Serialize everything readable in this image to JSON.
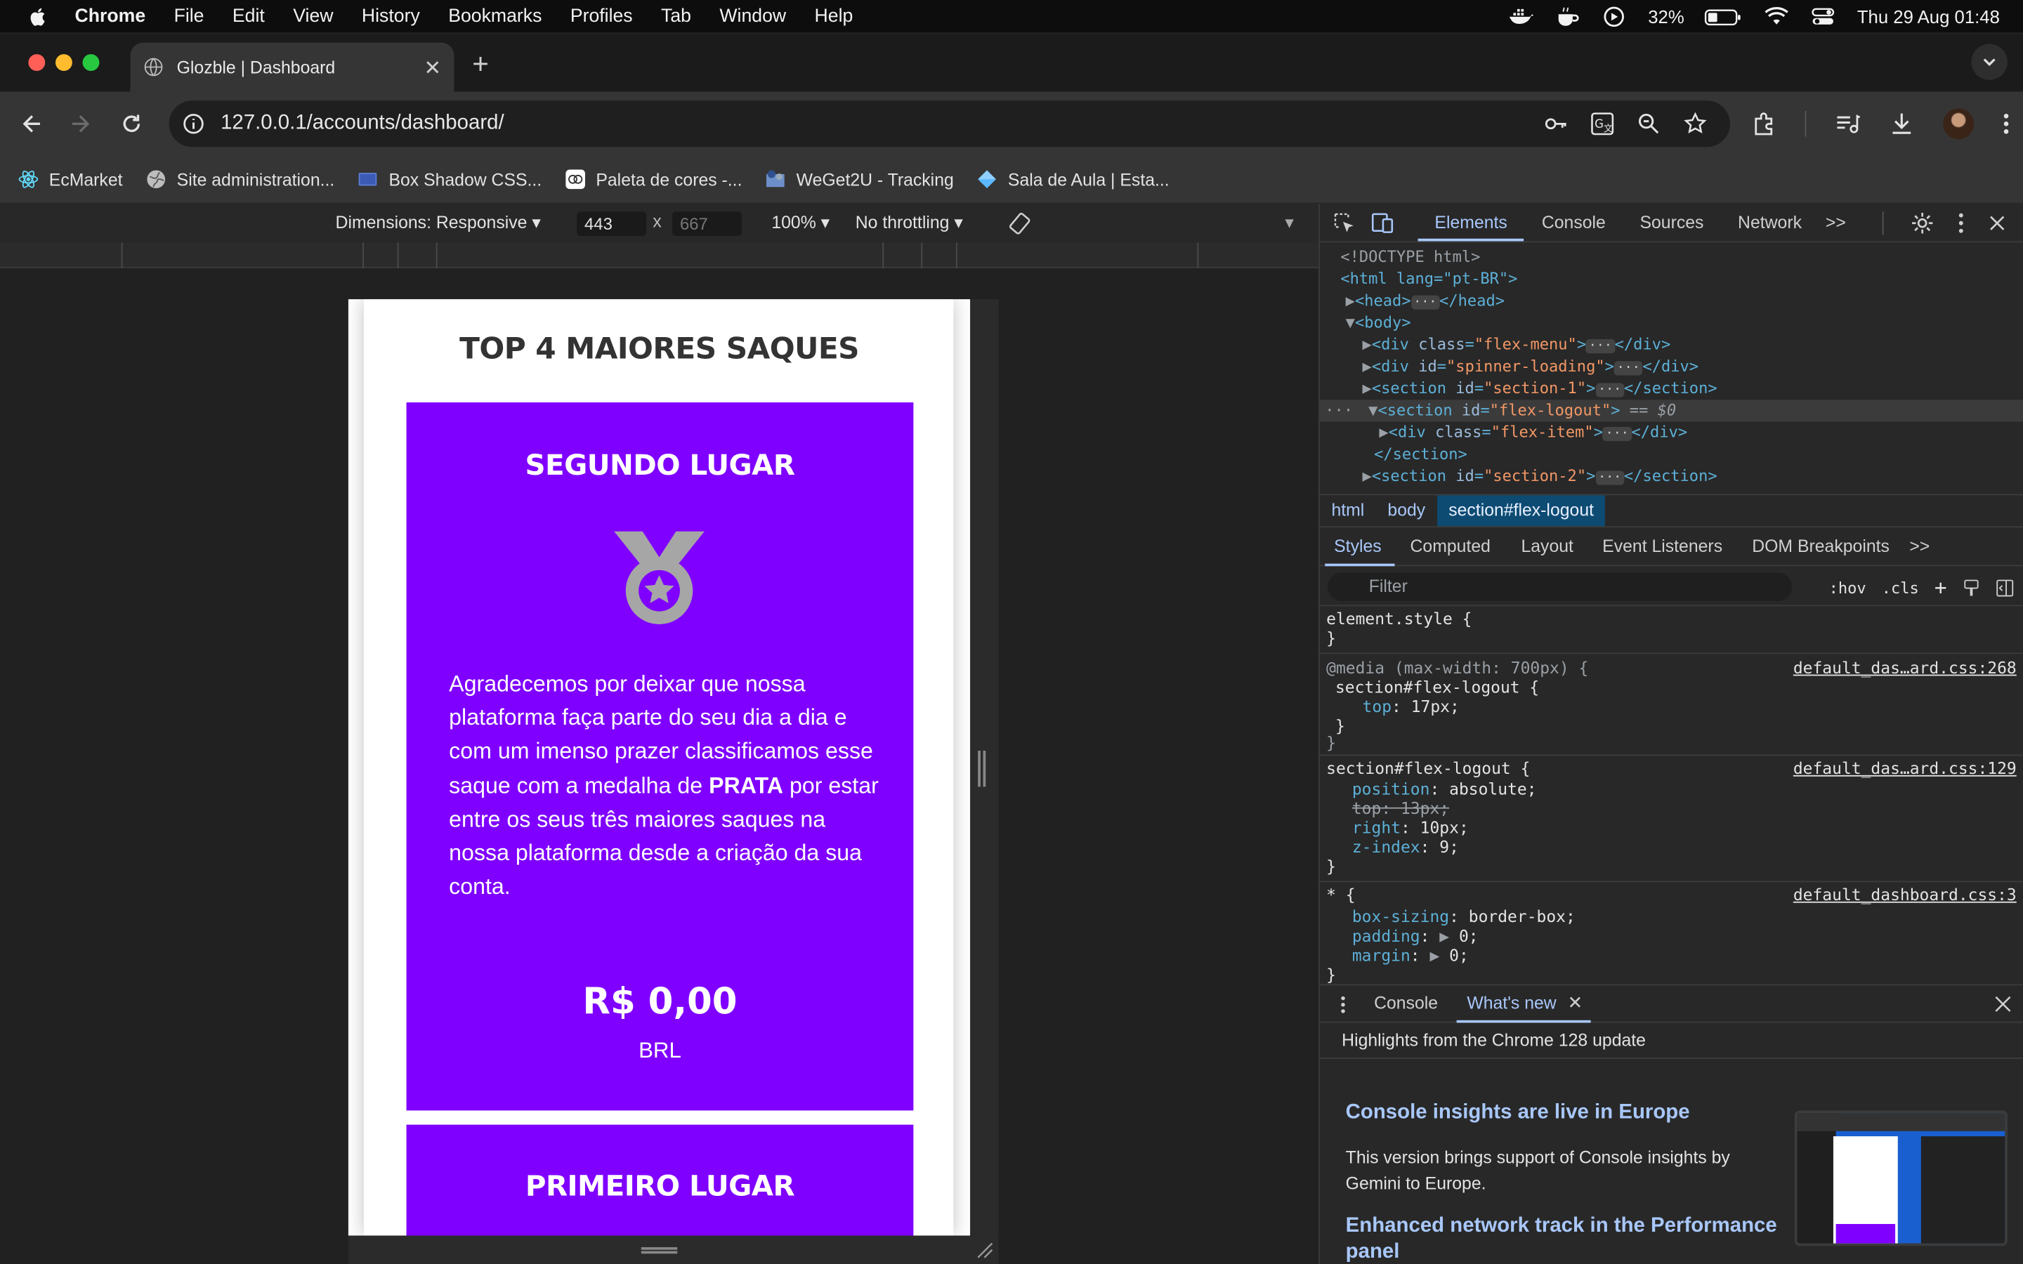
{
  "menubar": {
    "app": "Chrome",
    "items": [
      "File",
      "Edit",
      "View",
      "History",
      "Bookmarks",
      "Profiles",
      "Tab",
      "Window",
      "Help"
    ],
    "battery": "32%",
    "datetime": "Thu 29 Aug  01:48"
  },
  "tab": {
    "title": "Glozble | Dashboard"
  },
  "address": {
    "url": "127.0.0.1/accounts/dashboard/"
  },
  "bookmarks": [
    "EcMarket",
    "Site administration...",
    "Box Shadow CSS...",
    "Paleta de cores -...",
    "WeGet2U - Tracking",
    "Sala de Aula | Esta..."
  ],
  "device_toolbar": {
    "dimensions": "Dimensions: Responsive",
    "width": "443",
    "height": "667",
    "zoom": "100%",
    "throttling": "No throttling",
    "times": "x"
  },
  "page": {
    "title": "TOP 4 MAIORES SAQUES",
    "card1": {
      "title": "SEGUNDO LUGAR",
      "desc_before": "Agradecemos por deixar que nossa plataforma faça parte do seu dia a dia e com um imenso prazer classificamos esse saque com a medalha de ",
      "desc_bold": "PRATA",
      "desc_after": " por estar entre os seus três maiores saques na nossa plataforma desde a criação da sua conta.",
      "amount": "R$ 0,00",
      "currency": "BRL",
      "medal_color": "#a6a6a6"
    },
    "card2": {
      "title": "PRIMEIRO LUGAR"
    },
    "accent": "#7f00ff"
  },
  "devtools": {
    "tabs": [
      "Elements",
      "Console",
      "Sources",
      "Network"
    ],
    "more": ">>",
    "dom": {
      "doctype": "<!DOCTYPE html>",
      "html_open": "<html lang=\"pt-BR\">",
      "head": "<head>",
      "head_close": "</head>",
      "body": "<body>",
      "div_menu_attr": "class",
      "div_menu_val": "\"flex-menu\"",
      "div_spinner_attr": "id",
      "div_spinner_val": "\"spinner-loading\"",
      "section1_val": "\"section-1\"",
      "flexlogout_val": "\"flex-logout\"",
      "selected_marker": "== $0",
      "flexitem_val": "\"flex-item\"",
      "section_close": "</section>",
      "section2_val": "\"section-2\""
    },
    "breadcrumbs": [
      "html",
      "body",
      "section#flex-logout"
    ],
    "subtabs": [
      "Styles",
      "Computed",
      "Layout",
      "Event Listeners",
      "DOM Breakpoints"
    ],
    "filter_placeholder": "Filter",
    "filter_hov": ":hov",
    "filter_cls": ".cls",
    "styles": {
      "element_style": "element.style {",
      "close": "}",
      "media": "@media (max-width: 700px) {",
      "rule1_selector": "section#flex-logout {",
      "rule1_link": "default_das…ard.css:268",
      "rule1_prop": "top",
      "rule1_val": "17px;",
      "rule2_selector": "section#flex-logout {",
      "rule2_link": "default_das…ard.css:129",
      "rule2_props": [
        {
          "prop": "position",
          "val": "absolute;"
        },
        {
          "prop": "top",
          "val": "13px;",
          "struck": true
        },
        {
          "prop": "right",
          "val": "10px;"
        },
        {
          "prop": "z-index",
          "val": "9;"
        }
      ],
      "rule3_selector": "* {",
      "rule3_link": "default_dashboard.css:3",
      "rule3_props": [
        {
          "prop": "box-sizing",
          "val": "border-box;"
        },
        {
          "prop": "padding",
          "val": "0;"
        },
        {
          "prop": "margin",
          "val": "0;"
        }
      ]
    },
    "drawer": {
      "tabs": [
        "Console",
        "What's new"
      ],
      "highlights": "Highlights from the Chrome 128 update",
      "h1": "Console insights are live in Europe",
      "p1": "This version brings support of Console insights by Gemini to Europe.",
      "h2": "Enhanced network track in the Performance panel"
    }
  }
}
